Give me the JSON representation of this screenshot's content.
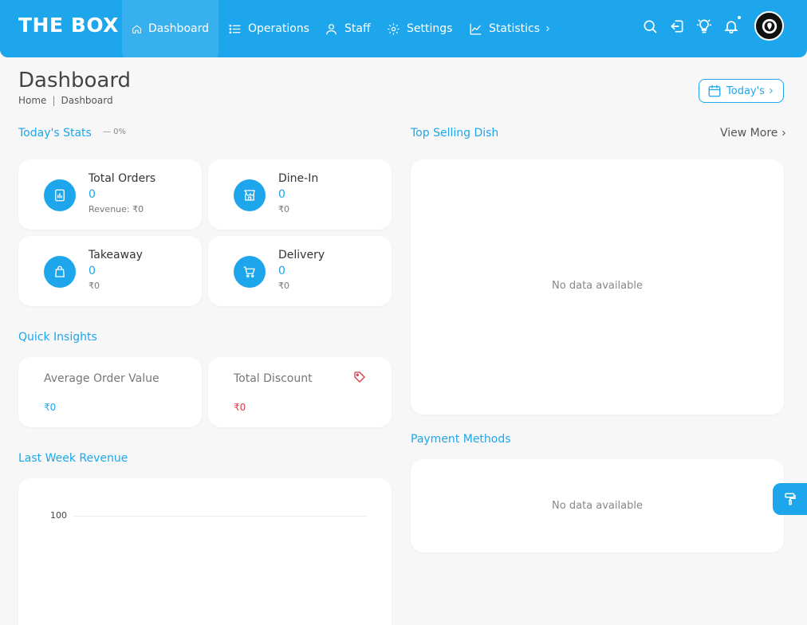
{
  "brand": "THE BOX",
  "nav": {
    "dashboard": "Dashboard",
    "operations": "Operations",
    "staff": "Staff",
    "settings": "Settings",
    "statistics": "Statistics"
  },
  "page": {
    "title": "Dashboard",
    "breadcrumb": {
      "home": "Home",
      "separator": "|",
      "current": "Dashboard"
    },
    "date_filter": "Today's"
  },
  "todays_stats": {
    "title": "Today's Stats",
    "change": "— 0%",
    "cards": [
      {
        "label": "Total Orders",
        "value": "0",
        "sub": "Revenue: ₹0",
        "icon": "report-icon"
      },
      {
        "label": "Dine-In",
        "value": "0",
        "sub": "₹0",
        "icon": "store-icon"
      },
      {
        "label": "Takeaway",
        "value": "0",
        "sub": "₹0",
        "icon": "bag-icon"
      },
      {
        "label": "Delivery",
        "value": "0",
        "sub": "₹0",
        "icon": "cart-icon"
      }
    ]
  },
  "quick_insights": {
    "title": "Quick Insights",
    "average_order_value": {
      "label": "Average Order Value",
      "value": "₹0"
    },
    "total_discount": {
      "label": "Total Discount",
      "value": "₹0"
    }
  },
  "last_week_revenue": {
    "title": "Last Week Revenue",
    "y_tick": "100"
  },
  "top_selling": {
    "title": "Top Selling Dish",
    "view_more": "View More",
    "empty": "No data available"
  },
  "payment_methods": {
    "title": "Payment Methods",
    "empty": "No data available"
  },
  "colors": {
    "primary": "#1ea6ec",
    "discount": "#d63b4a",
    "background": "#f7f7f8"
  }
}
